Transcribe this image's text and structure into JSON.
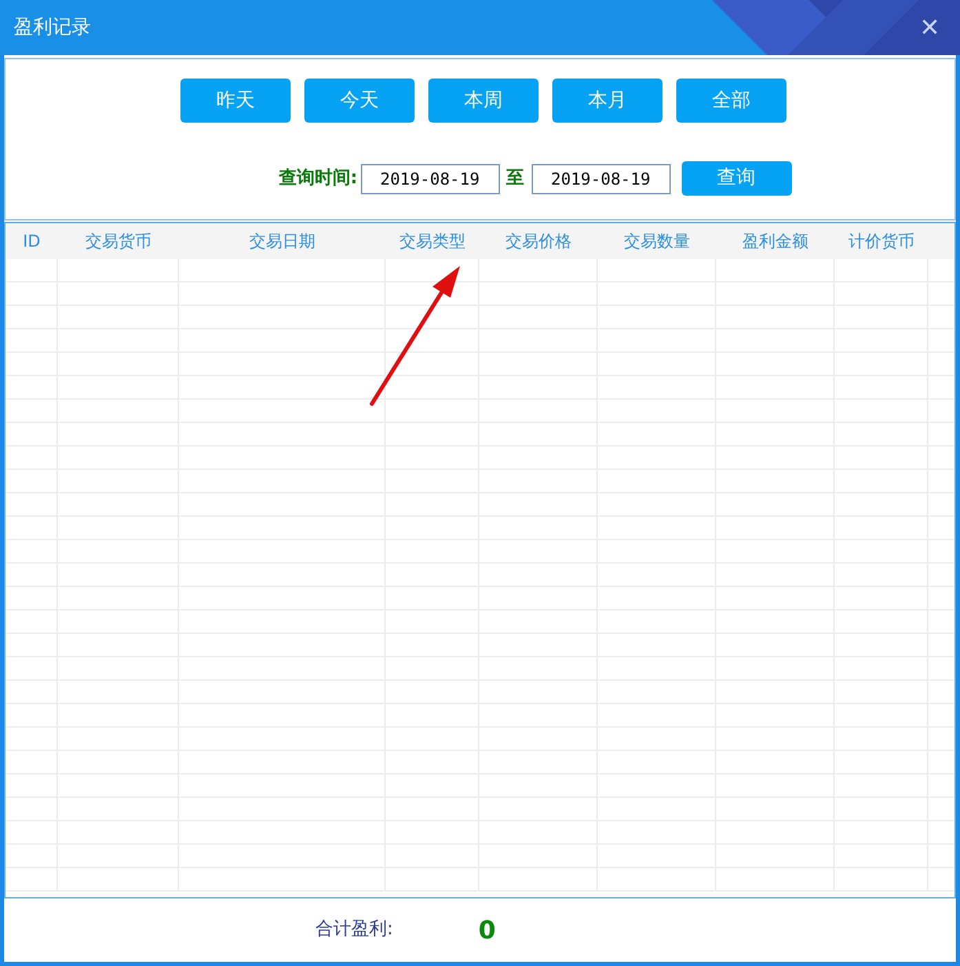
{
  "window": {
    "title": "盈利记录",
    "close": "✕"
  },
  "range_buttons": [
    "昨天",
    "今天",
    "本周",
    "本月",
    "全部"
  ],
  "query": {
    "label": "查询时间:",
    "from": "2019-08-19",
    "separator": "至",
    "to": "2019-08-19",
    "button": "查询"
  },
  "table": {
    "columns": [
      "ID",
      "交易货币",
      "交易日期",
      "交易类型",
      "交易价格",
      "交易数量",
      "盈利金额",
      "计价货币"
    ]
  },
  "footer": {
    "label": "合计盈利:",
    "value": "0"
  }
}
